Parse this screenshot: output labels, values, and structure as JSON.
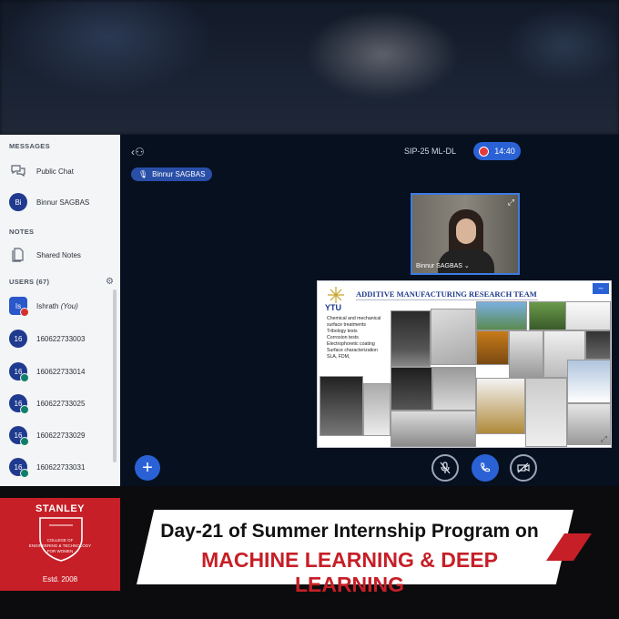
{
  "sidebar": {
    "messages_heading": "MESSAGES",
    "public_chat": "Public Chat",
    "private_chat": {
      "initials": "Bi",
      "name": "Binnur SAGBAS"
    },
    "notes_heading": "NOTES",
    "shared_notes": "Shared Notes",
    "users_heading": "USERS (67)",
    "users": [
      {
        "initials": "Is",
        "name": "Ishrath",
        "suffix": "(You)"
      },
      {
        "initials": "16",
        "name": "160622733003"
      },
      {
        "initials": "16",
        "name": "160622733014"
      },
      {
        "initials": "16",
        "name": "160622733025"
      },
      {
        "initials": "16",
        "name": "160622733029"
      },
      {
        "initials": "16",
        "name": "160622733031"
      }
    ]
  },
  "main": {
    "meeting_title": "SIP-25 ML-DL",
    "timer": "14:40",
    "talking_indicator": "Binnur SAGBAS",
    "webcam_name": "Binnur SAGBAS",
    "webcam_name_caret": "⌄"
  },
  "slide": {
    "logo_text": "YTU",
    "title": "ADDITIVE MANUFACTURING RESEARCH TEAM",
    "bullets": [
      "Chemical and mechanical",
      "surface treatments",
      "Tribology tests",
      "Corrosion tests",
      "Electrophoretic coating",
      "Surface characterization",
      "SLA, FDM,"
    ]
  },
  "banner": {
    "college_name": "STANLEY",
    "shield_text_1": "COLLEGE OF",
    "shield_text_2": "ENGINEERING & TECHNOLOGY",
    "shield_text_3": "FOR WOMEN",
    "established": "Estd. 2008",
    "line1": "Day-21 of Summer Internship Program on",
    "line2": "MACHINE LEARNING & DEEP LEARNING"
  },
  "colors": {
    "accent_blue": "#2a62d6",
    "brand_red": "#c61f27",
    "sidebar_bg": "#f4f5f7",
    "main_bg": "#06101f"
  }
}
